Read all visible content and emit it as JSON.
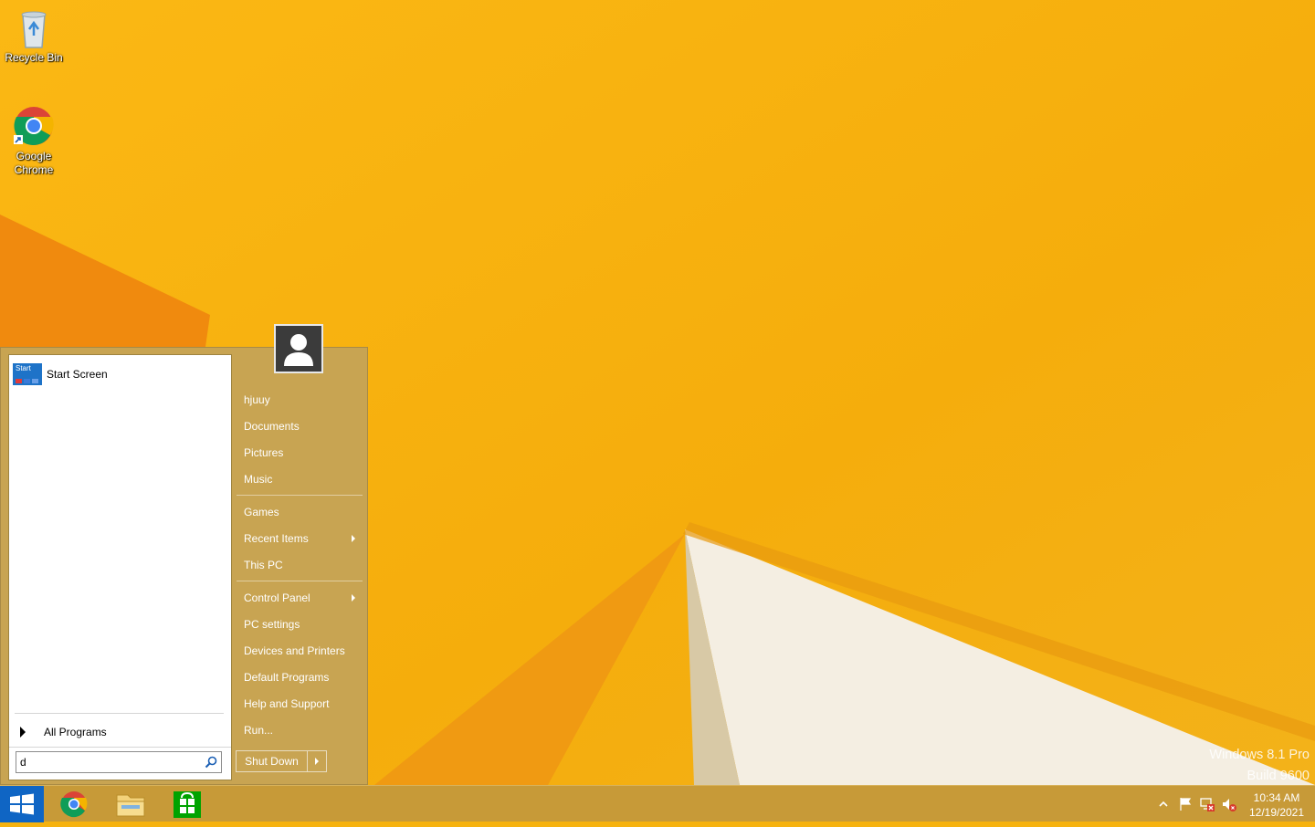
{
  "desktop": {
    "icons": [
      {
        "label": "Recycle Bin",
        "icon": "recycle-bin-icon"
      },
      {
        "label": "Google Chrome",
        "icon": "chrome-icon"
      }
    ],
    "watermark": {
      "line1": "Windows 8.1 Pro",
      "line2": "Build 9600"
    }
  },
  "start_menu": {
    "pinned": {
      "label": "Start Screen",
      "tile_text": "Start"
    },
    "all_programs": "All Programs",
    "search": {
      "value": "d",
      "placeholder": ""
    },
    "user_icon": "user-avatar-icon",
    "right_items": [
      {
        "label": "hjuuy"
      },
      {
        "label": "Documents"
      },
      {
        "label": "Pictures"
      },
      {
        "label": "Music"
      },
      {
        "label": "Games"
      },
      {
        "label": "Recent Items",
        "submenu": true
      },
      {
        "label": "This PC"
      },
      {
        "label": "Control Panel",
        "submenu": true
      },
      {
        "label": "PC settings"
      },
      {
        "label": "Devices and Printers"
      },
      {
        "label": "Default Programs"
      },
      {
        "label": "Help and Support"
      },
      {
        "label": "Run..."
      }
    ],
    "shutdown": "Shut Down"
  },
  "taskbar": {
    "start_icon": "windows-logo-icon",
    "apps": [
      "chrome-icon",
      "file-explorer-icon",
      "store-icon"
    ],
    "tray_icons": [
      "show-hidden-icons-chevron",
      "action-center-flag-icon",
      "network-disconnected-icon",
      "volume-muted-icon"
    ],
    "time": "10:34 AM",
    "date": "12/19/2021"
  },
  "colors": {
    "wallpaper": "#f6b20e",
    "start_menu_bg": "#c8a452",
    "taskbar_bg": "#c79a38",
    "start_button": "#0f65c4"
  }
}
